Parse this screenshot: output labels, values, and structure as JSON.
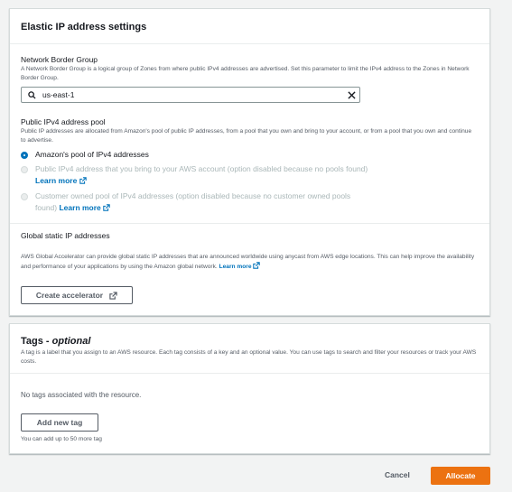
{
  "elastic_ip_settings": {
    "title": "Elastic IP address settings",
    "network_border_group": {
      "label": "Network Border Group",
      "description": "A Network Border Group is a logical group of Zones from where public IPv4 addresses are advertised. Set this parameter to limit the IPv4 address to the Zones in Network Border Group.",
      "value": "us-east-1"
    },
    "pool": {
      "label": "Public IPv4 address pool",
      "description": "Public IP addresses are allocated from Amazon's pool of public IP addresses, from a pool that you own and bring to your account, or from a pool that you own and continue to advertise.",
      "options": [
        {
          "label": "Amazon's pool of IPv4 addresses",
          "selected": true,
          "disabled": false
        },
        {
          "label": "Public IPv4 address that you bring to your AWS account (option disabled because no pools found)",
          "link": "Learn more",
          "selected": false,
          "disabled": true
        },
        {
          "label": "Customer owned pool of IPv4 addresses (option disabled because no customer owned pools found)",
          "link": "Learn more",
          "selected": false,
          "disabled": true
        }
      ]
    },
    "global_static": {
      "label": "Global static IP addresses",
      "description": "AWS Global Accelerator can provide global static IP addresses that are announced worldwide using anycast from AWS edge locations. This can help improve the availability and performance of your applications by using the Amazon global network.",
      "link": "Learn more",
      "button": "Create accelerator"
    }
  },
  "tags": {
    "title": "Tags",
    "title_suffix": "optional",
    "description": "A tag is a label that you assign to an AWS resource. Each tag consists of a key and an optional value. You can use tags to search and filter your resources or track your AWS costs.",
    "empty_text": "No tags associated with the resource.",
    "add_button": "Add new tag",
    "limit_text": "You can add up to 50 more tag"
  },
  "footer": {
    "cancel": "Cancel",
    "allocate": "Allocate"
  },
  "colors": {
    "primary": "#ec7211",
    "link": "#0073bb",
    "disabled_text": "#aab7b8"
  }
}
